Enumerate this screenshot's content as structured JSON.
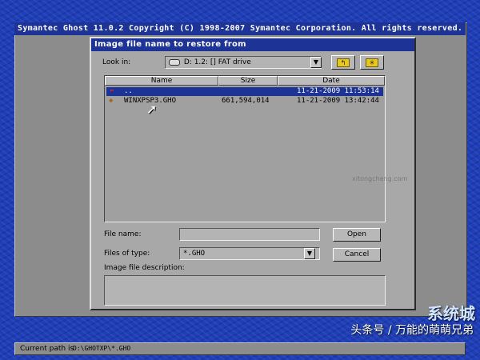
{
  "app": {
    "title": "Symantec Ghost 11.0.2   Copyright (C) 1998-2007 Symantec Corporation. All rights reserved."
  },
  "dialog": {
    "title": "Image file name to restore from",
    "look_in_label": "Look in:",
    "look_in_value": "D: 1.2: [] FAT drive",
    "columns": [
      "Name",
      "Size",
      "Date"
    ],
    "rows": [
      {
        "name": "..",
        "size": "",
        "date": "11-21-2009 11:53:14",
        "selected": true,
        "icon": "up-folder-icon"
      },
      {
        "name": "WINXPSP3.GHO",
        "size": "661,594,014",
        "date": "11-21-2009 13:42:44",
        "selected": false,
        "icon": "ghost-image-file-icon"
      }
    ],
    "file_name_label": "File name:",
    "file_name_value": "",
    "files_of_type_label": "Files of type:",
    "files_of_type_value": "*.GHO",
    "description_label": "Image file description:",
    "description_value": "",
    "open_label": "Open",
    "cancel_label": "Cancel"
  },
  "status": {
    "label": "Current path is",
    "path": "D:\\GHOTXP\\*.GHO"
  },
  "watermark": {
    "text": "头条号 / 万能的萌萌兄弟",
    "logo": "系统城",
    "site": "xitongcheng.com"
  },
  "colors": {
    "desktop": "#1f3fb8",
    "titlebar": "#1d3396",
    "panel": "#a8a8a8"
  }
}
